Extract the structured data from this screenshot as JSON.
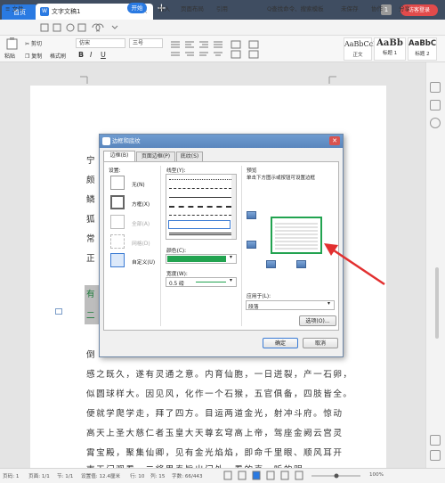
{
  "titlebar": {
    "home_tab": "首页",
    "doc_tab": "文字文稿1",
    "doc_icon": "W",
    "close": "×",
    "plus": "+",
    "badge": "1",
    "login": "访客登录"
  },
  "menubar": {
    "file": "≡ 文件",
    "items": [
      "开始",
      "插入",
      "页面布局",
      "引用",
      "审阅",
      "视图",
      "章节",
      "开发工具",
      "会员专享"
    ],
    "search": "Q查找命令、搜索模板",
    "right": [
      "未保存",
      "协作",
      "分享"
    ]
  },
  "ribbon": {
    "paste": "粘贴",
    "cut": "剪切",
    "copy": "复制",
    "format_painter": "格式刷",
    "font": "仿宋",
    "size": "三号",
    "bold": "B",
    "italic": "I",
    "underline": "U",
    "styles": [
      {
        "sample": "AaBbCcDd",
        "name": "正文"
      },
      {
        "sample": "AaBb",
        "name": "标题 1"
      },
      {
        "sample": "AaBbC",
        "name": "标题 2"
      }
    ]
  },
  "document": {
    "side_chars": [
      "宁",
      "颇",
      "鳞",
      "狐",
      "常",
      "正"
    ],
    "highlight_chars": [
      "有",
      "二"
    ],
    "lines": [
      "倒",
      "感之既久，遂有灵通之意。内育仙胞，一日迸裂，产一石卵，",
      "似圆球样大。因见风，化作一个石猴，五官俱备，四肢皆全。",
      "便就学爬学走，拜了四方。目运两道金光，射冲斗府。惊动",
      "高天上圣大慈仁者玉皇大天尊玄穹高上帝，驾座金阙云宫灵",
      "霄宝殿，聚集仙卿，见有金光焰焰，即命千里眼、顺风耳开",
      "南天门观看。二将果奉旨出门外，看的真，听的明。"
    ]
  },
  "dialog": {
    "title": "边框和底纹",
    "tabs": [
      "边框(B)",
      "页面边框(P)",
      "底纹(S)"
    ],
    "setting_label": "设置:",
    "settings": [
      "无(N)",
      "方框(X)",
      "全部(A)",
      "网格(D)",
      "自定义(U)"
    ],
    "linestyle_label": "线型(Y):",
    "color_label": "颜色(C):",
    "color_value": "#22a350",
    "width_label": "宽度(W):",
    "width_value": "0.5  磅",
    "preview_label": "预览",
    "preview_hint": "单击下方图示或按钮可设置边框",
    "apply_label": "应用于(L):",
    "apply_value": "段落",
    "options_button": "选项(O)...",
    "ok_button": "确定",
    "cancel_button": "取消"
  },
  "status": {
    "page": "页码: 1",
    "pages": "页面: 1/1",
    "section": "节: 1/1",
    "setting": "设置值: 12.4厘米",
    "row": "行: 10",
    "col": "列: 15",
    "words": "字数: 66/443",
    "zoom": "100%"
  },
  "colors": {
    "accent": "#2a7ae2",
    "titlebar": "#3f4d61",
    "highlight_green": "#22a350",
    "arrow": "#e23030"
  }
}
